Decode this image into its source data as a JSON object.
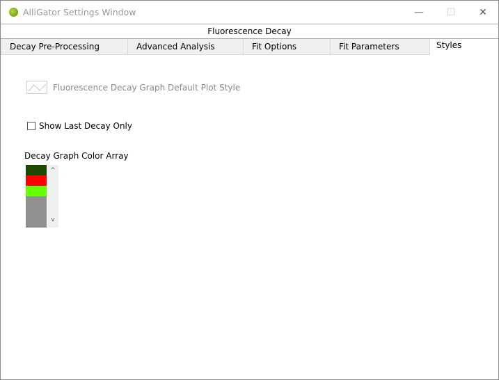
{
  "window": {
    "title": "AlliGator Settings Window",
    "minimize": "—",
    "maximize": "☐",
    "close": "✕"
  },
  "header": {
    "title": "Fluorescence Decay"
  },
  "tabs": [
    {
      "label": "Decay Pre-Processing"
    },
    {
      "label": "Advanced Analysis"
    },
    {
      "label": "Fit Options"
    },
    {
      "label": "Fit Parameters"
    },
    {
      "label": "Styles",
      "selected": true
    }
  ],
  "styles": {
    "plot_style_label": "Fluorescence Decay Graph Default Plot Style",
    "show_last_label": "Show Last Decay Only",
    "show_last_checked": false,
    "color_array_label": "Decay Graph Color Array",
    "colors": [
      "#1e4a00",
      "#ff0000",
      "#66ff00",
      "#909090"
    ],
    "scroll_up": "^",
    "scroll_down": "v"
  }
}
